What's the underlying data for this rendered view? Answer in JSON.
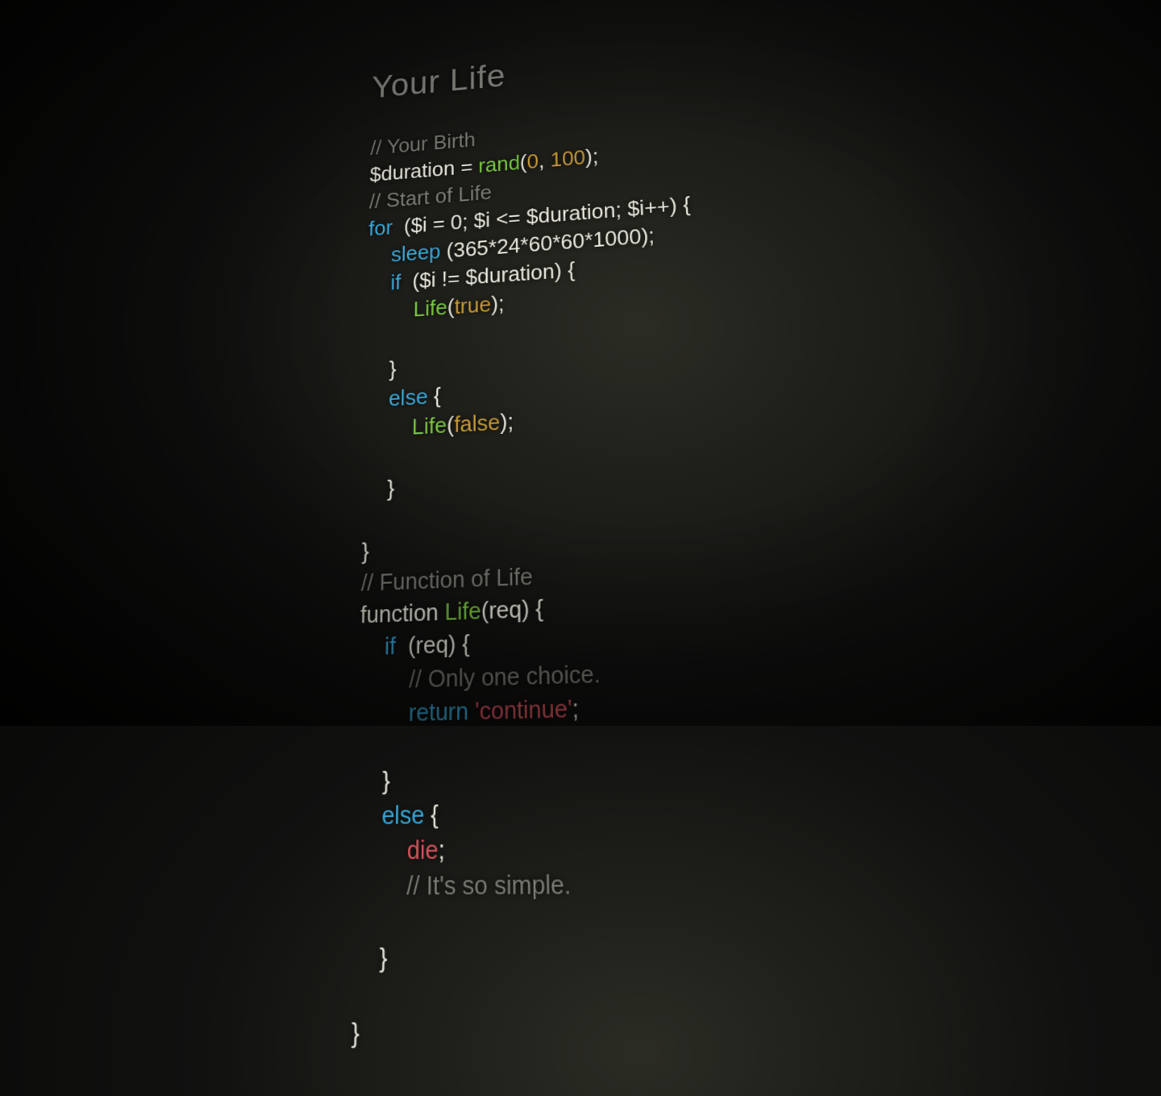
{
  "title": "Your Life",
  "comments": {
    "birth": "// Your Birth",
    "start": "// Start of Life",
    "funcOf": "// Function of Life",
    "onlyChoice": "// Only one choice.",
    "simple": "// It's so simple."
  },
  "tokens": {
    "durationVar": "$duration",
    "assign": " = ",
    "rand": "rand",
    "lp": "(",
    "rp": ")",
    "zero": "0",
    "comma": ", ",
    "hundred": "100",
    "semi": ";",
    "for": "for",
    "iInit": "$i = 0; $i <= $duration; $i++",
    "lbrace": " {",
    "sleep": "sleep",
    "sleepArg": " (365*24*60*60*1000);",
    "if": "if",
    "ifCond": "  ($i != $duration) {",
    "lifeFn": "Life",
    "true": "true",
    "false": "false",
    "rbrace": "}",
    "else": "else",
    "elseBrace": " {",
    "function": "function ",
    "funcSig": "(req) {",
    "ifReq": "  (req) {",
    "return": "return ",
    "continueStr": "'continue'",
    "die": "die"
  },
  "space": {
    "ind1": "    ",
    "ind2": "        ",
    "ind3": "            ",
    "forGap": "  ("
  }
}
